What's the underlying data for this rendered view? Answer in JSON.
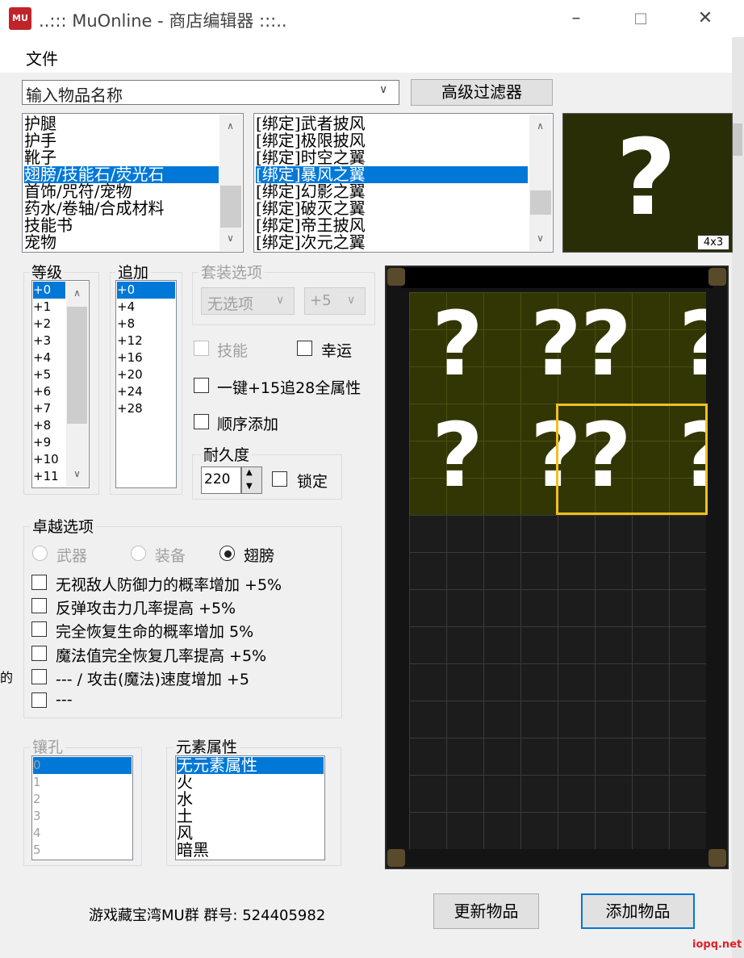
{
  "window": {
    "title": "..::: MuOnline - 商店编辑器 :::..",
    "icon_text": "MU"
  },
  "menu": {
    "file": "文件"
  },
  "search": {
    "placeholder": "输入物品名称",
    "advanced_filter": "高级过滤器"
  },
  "category_list": {
    "items": [
      "护腿",
      "护手",
      "靴子",
      "翅膀/技能石/荧光石",
      "首饰/咒符/宠物",
      "药水/卷轴/合成材料",
      "技能书",
      "宠物"
    ],
    "selected": "翅膀/技能石/荧光石"
  },
  "item_list": {
    "items": [
      "[绑定]武者披风",
      "[绑定]极限披风",
      "[绑定]时空之翼",
      "[绑定]暴风之翼",
      "[绑定]幻影之翼",
      "[绑定]破灭之翼",
      "[绑定]帝王披风",
      "[绑定]次元之翼"
    ],
    "selected": "[绑定]暴风之翼"
  },
  "preview": {
    "glyph": "?",
    "size": "4x3"
  },
  "level": {
    "label": "等级",
    "items": [
      "+0",
      "+1",
      "+2",
      "+3",
      "+4",
      "+5",
      "+6",
      "+7",
      "+8",
      "+9",
      "+10",
      "+11"
    ],
    "selected": "+0"
  },
  "additional": {
    "label": "追加",
    "items": [
      "+0",
      "+4",
      "+8",
      "+12",
      "+16",
      "+20",
      "+24",
      "+28"
    ],
    "selected": "+0"
  },
  "set_options": {
    "label": "套装选项",
    "set_value": "无选项",
    "set_level": "+5"
  },
  "options": {
    "skill": "技能",
    "luck": "幸运",
    "one_click": "一键+15追28全属性",
    "sequential_add": "顺序添加"
  },
  "durability": {
    "label": "耐久度",
    "value": "220",
    "lock": "锁定"
  },
  "excellent": {
    "label": "卓越选项",
    "types": [
      "武器",
      "装备",
      "翅膀"
    ],
    "selected_type": "翅膀",
    "options": [
      "无视敌人防御力的概率增加 +5%",
      "反弹攻击力几率提高 +5%",
      "完全恢复生命的概率增加 5%",
      "魔法值完全恢复几率提高 +5%",
      "--- / 攻击(魔法)速度增加 +5",
      "---"
    ]
  },
  "sockets": {
    "label": "镶孔",
    "items": [
      "0",
      "1",
      "2",
      "3",
      "4",
      "5"
    ],
    "selected": "0"
  },
  "element": {
    "label": "元素属性",
    "items": [
      "无元素属性",
      "火",
      "水",
      "土",
      "风",
      "暗黑"
    ],
    "selected": "无元素属性"
  },
  "footer": {
    "info": "游戏藏宝湾MU群 群号: 524405982",
    "update_button": "更新物品",
    "add_button": "添加物品",
    "watermark": "iopq.net",
    "left_edge_char": "的"
  },
  "inventory": {
    "grid_columns": 8,
    "grid_rows": 15,
    "item_glyph": "?"
  }
}
